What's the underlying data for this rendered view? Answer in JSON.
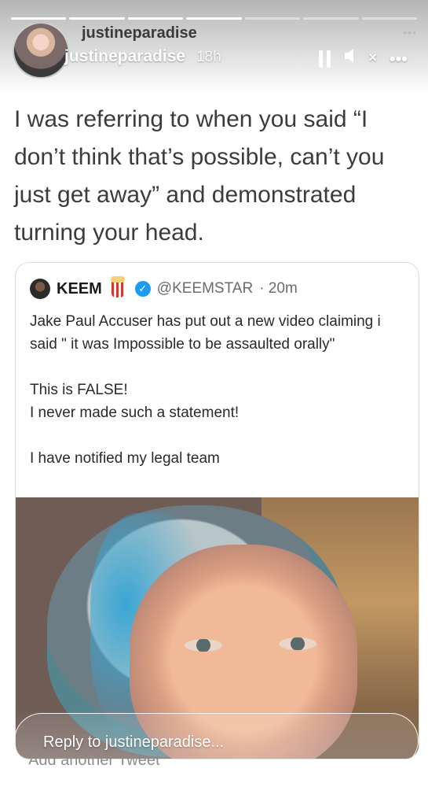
{
  "story": {
    "segments_total": 7,
    "segments_done": 4,
    "progress_color": "#ffffff"
  },
  "header": {
    "username_top": "justineparadise",
    "username": "justineparadise",
    "time_ago": "18h",
    "menu_dots_small": "•••",
    "more_label": "•••",
    "mute_x": "×",
    "icons": [
      "pause-icon",
      "mute-icon",
      "more-icon",
      "avatar"
    ]
  },
  "caption": "I was referring to when you said “I don’t think that’s possible, can’t you just get away” and demonstrated turning your head.",
  "tweet": {
    "name": "KEEM",
    "handle": "@KEEMSTAR",
    "time": "· 20m",
    "verified_color": "#1d9bf0",
    "verified_symbol": "✓",
    "paragraphs": [
      "Jake Paul Accuser has put out a new video claiming i said \" it was Impossible to be assaulted orally\"",
      "This is FALSE!\nI never made such a statement!",
      "I have notified my legal team"
    ]
  },
  "footer": {
    "reply_placeholder": "Reply to justineparadise...",
    "add_tweet_text": "Add another Tweet"
  }
}
